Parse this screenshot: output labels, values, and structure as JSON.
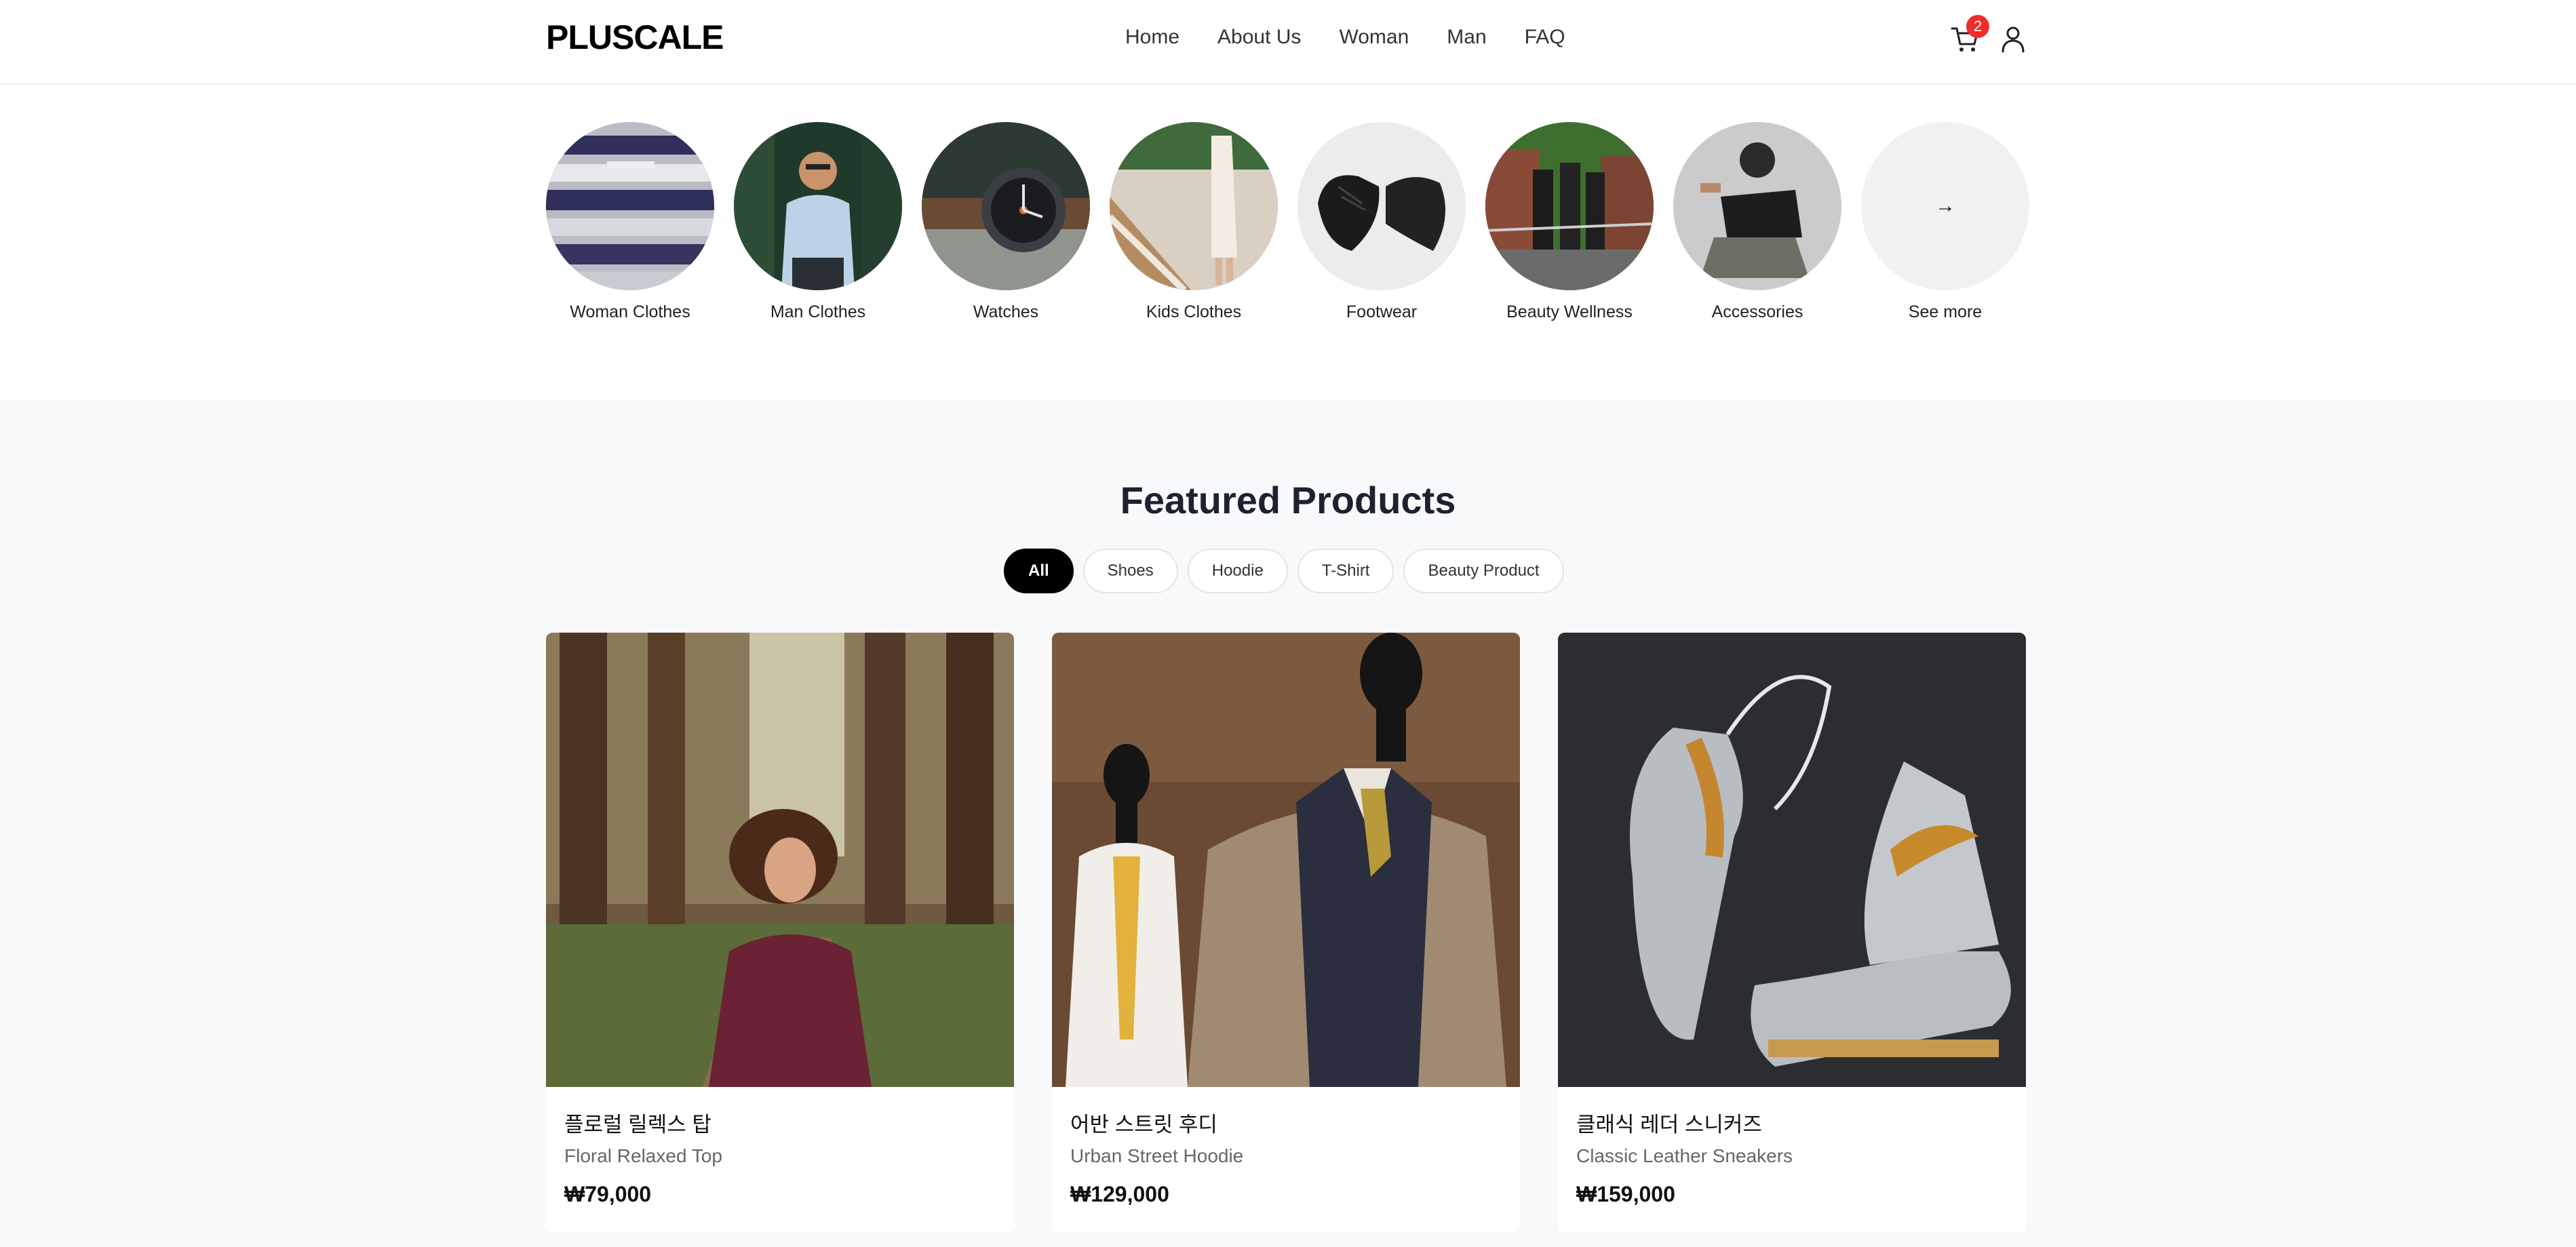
{
  "brand": {
    "logo": "PLUSCALE"
  },
  "nav": [
    "Home",
    "About Us",
    "Woman",
    "Man",
    "FAQ"
  ],
  "header": {
    "cart_count": "2"
  },
  "categories": [
    {
      "label": "Woman Clothes"
    },
    {
      "label": "Man Clothes"
    },
    {
      "label": "Watches"
    },
    {
      "label": "Kids Clothes"
    },
    {
      "label": "Footwear"
    },
    {
      "label": "Beauty Wellness"
    },
    {
      "label": "Accessories"
    },
    {
      "label": "See more",
      "icon": "arrow-right-icon"
    }
  ],
  "featured": {
    "title": "Featured Products",
    "filters": [
      "All",
      "Shoes",
      "Hoodie",
      "T-Shirt",
      "Beauty Product"
    ],
    "active_filter": "All",
    "products": [
      {
        "name_ko": "플로럴 릴렉스 탑",
        "name_en": "Floral Relaxed Top",
        "price": "₩79,000"
      },
      {
        "name_ko": "어반 스트릿 후디",
        "name_en": "Urban Street Hoodie",
        "price": "₩129,000"
      },
      {
        "name_ko": "클래식 레더 스니커즈",
        "name_en": "Classic Leather Sneakers",
        "price": "₩159,000"
      }
    ]
  },
  "colors": {
    "badge": "#ef2b2b",
    "active_chip": "#000000",
    "page_bg": "#f8f9fa"
  }
}
